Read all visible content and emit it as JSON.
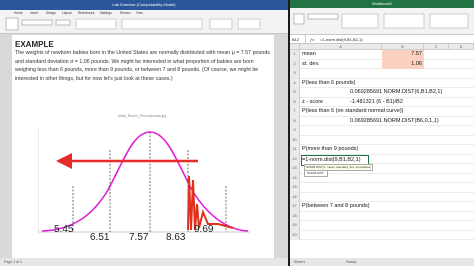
{
  "word": {
    "title": "Lab Exercise (Computability Model)",
    "tabs": [
      "Home",
      "Insert",
      "Design",
      "Layout",
      "References",
      "Mailings",
      "Review",
      "View"
    ],
    "heading": "EXAMPLE",
    "paragraph": "The weights of newborn babies born in the United States are normally distributed with mean μ = 7.57 pounds and standard deviation σ = 1.06 pounds.  We might be interested in what proportion of babies are born weighing less than 6 pounds, more than 9 pounds, or between 7 and 8 pounds. (Of course, we might be interested in other things, but for now let's just look at these cases.)",
    "caption": "Math_Rubric_Pennsylvania.jpg",
    "ticks": [
      "5.45",
      "6.51",
      "7.57",
      "8.63",
      "9.69"
    ],
    "status": "Page 1 of 1",
    "colors": {
      "curve": "#e21fd6",
      "arrow": "#e52b2b",
      "sketch": "#e0311c"
    }
  },
  "excel": {
    "title": "Workbook1",
    "name_box": "B12",
    "formula": "=1-norm.dist(9,B1,B2,1)",
    "col_headers": [
      "A",
      "B",
      "C",
      "D"
    ],
    "rows": [
      {
        "n": "1",
        "a": "mean",
        "b": "7.57"
      },
      {
        "n": "2",
        "a": "st. dev.",
        "b": "1.06"
      },
      {
        "n": "3",
        "a": "",
        "b": ""
      },
      {
        "n": "4",
        "a": "P(less than 6 pounds)",
        "b": ""
      },
      {
        "n": "5",
        "a": "",
        "b": "",
        "r": "0.069285691 NORM.DIST(6,B1,B2,1)"
      },
      {
        "n": "6",
        "a": "z - score",
        "b": "",
        "r": "-1.481321 (6 - B1)/B2"
      },
      {
        "n": "7",
        "a": "P(less than 6 (on standard normal curve))",
        "b": ""
      },
      {
        "n": "8",
        "a": "",
        "b": "",
        "r": "0.069285691 NORM.DIST(B6,0,1,1)"
      },
      {
        "n": "9",
        "a": "",
        "b": ""
      },
      {
        "n": "10",
        "a": "",
        "b": ""
      },
      {
        "n": "11",
        "a": "P(more than 9 pounds)",
        "b": ""
      },
      {
        "n": "12",
        "a": "=1-norm.dist(9,B1,B2,1)",
        "b": ""
      },
      {
        "n": "13",
        "a": "",
        "b": ""
      },
      {
        "n": "14",
        "a": "",
        "b": ""
      },
      {
        "n": "15",
        "a": "",
        "b": ""
      },
      {
        "n": "16",
        "a": "",
        "b": ""
      },
      {
        "n": "17",
        "a": "P(between 7 and 8 pounds)",
        "b": ""
      },
      {
        "n": "18",
        "a": "",
        "b": ""
      },
      {
        "n": "19",
        "a": "",
        "b": ""
      },
      {
        "n": "20",
        "a": "",
        "b": ""
      }
    ],
    "tooltip": "NORM.DIST(x, mean, standard_dev, cumulative)",
    "autocomplete": "NORM.DIST",
    "sheet_tab": "Sheet1",
    "status": "Ready"
  }
}
